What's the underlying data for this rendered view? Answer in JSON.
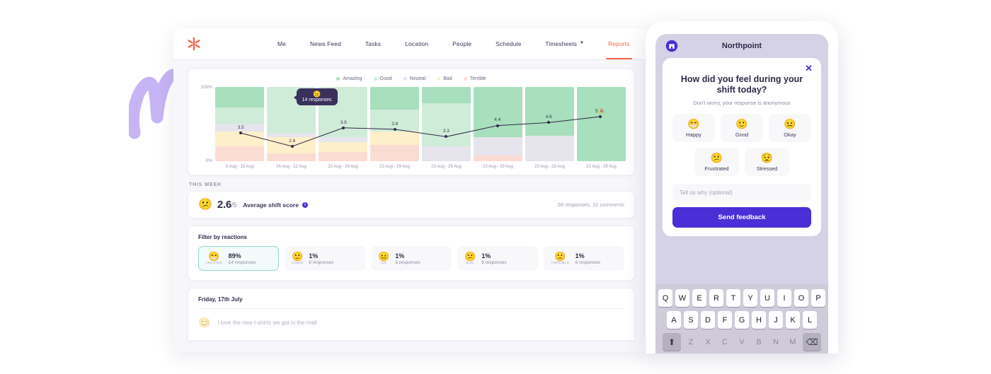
{
  "nav": {
    "logo_icon": "asterisk-logo-icon",
    "items": [
      {
        "label": "Me",
        "active": false,
        "caret": false
      },
      {
        "label": "News Feed",
        "active": false,
        "caret": false
      },
      {
        "label": "Tasks",
        "active": false,
        "caret": false
      },
      {
        "label": "Location",
        "active": false,
        "caret": false
      },
      {
        "label": "People",
        "active": false,
        "caret": false
      },
      {
        "label": "Schedule",
        "active": false,
        "caret": false
      },
      {
        "label": "Timesheets",
        "active": false,
        "caret": true
      },
      {
        "label": "Reports",
        "active": true,
        "caret": false
      }
    ]
  },
  "chart_data": {
    "type": "bar",
    "title": "",
    "xlabel": "",
    "ylabel": "",
    "ylim": [
      0,
      100
    ],
    "y_ticks": [
      "100%",
      "0%"
    ],
    "grid": false,
    "legend_position": "top-center",
    "legend": [
      {
        "name": "Amazing",
        "color": "#a8dfbc"
      },
      {
        "name": "Good",
        "color": "#cfecd8"
      },
      {
        "name": "Neutral",
        "color": "#e6e4ec"
      },
      {
        "name": "Bad",
        "color": "#fdefc9"
      },
      {
        "name": "Terrible",
        "color": "#fbdcd2"
      }
    ],
    "categories": [
      "9 Aug - 15 Aug",
      "16 Aug - 22 Aug",
      "23 Aug - 29 Aug",
      "23 Aug - 29 Aug",
      "23 Aug - 29 Aug",
      "23 Aug - 29 Aug",
      "23 Aug - 29 Aug",
      "23 Aug - 29 Aug"
    ],
    "series": [
      {
        "name": "Amazing",
        "values": [
          28,
          0,
          0,
          30,
          22,
          68,
          66,
          100
        ]
      },
      {
        "name": "Good",
        "values": [
          22,
          62,
          68,
          30,
          58,
          0,
          0,
          0
        ]
      },
      {
        "name": "Neutral",
        "values": [
          10,
          6,
          6,
          0,
          20,
          24,
          34,
          0
        ]
      },
      {
        "name": "Bad",
        "values": [
          20,
          22,
          14,
          18,
          0,
          0,
          0,
          0
        ]
      },
      {
        "name": "Terrible",
        "values": [
          20,
          10,
          12,
          22,
          0,
          8,
          0,
          0
        ]
      }
    ],
    "line_series": {
      "name": "Average shift score",
      "color": "#2f2947",
      "labels": [
        "3.5",
        "2.6",
        "3.9",
        "3.8",
        "3.3",
        "4.4",
        "4.6",
        "5 🎉"
      ],
      "values": [
        3.5,
        2.6,
        3.9,
        3.8,
        3.3,
        4.4,
        4.6,
        5.0
      ],
      "y_positions_pct": [
        62,
        80,
        55,
        57,
        67,
        52,
        48,
        40
      ]
    },
    "tooltip": {
      "emoji": "😐",
      "text": "14 responses",
      "bar_index": 1
    }
  },
  "this_week": {
    "section_label": "THIS WEEK",
    "emoji": "😕",
    "score": "2.6",
    "denominator": "/5",
    "label": "Average shift score",
    "info_icon": "info-icon",
    "summary": "58 responses, 32 comments"
  },
  "filters": {
    "title": "Filter by reactions",
    "chips": [
      {
        "emoji": "😁",
        "category": "AMAZING",
        "pct": "89%",
        "responses": "14 responses",
        "selected": true
      },
      {
        "emoji": "🙂",
        "category": "GOOD",
        "pct": "1%",
        "responses": "6 responses",
        "selected": false
      },
      {
        "emoji": "😐",
        "category": "OK",
        "pct": "1%",
        "responses": "6 responses",
        "selected": false
      },
      {
        "emoji": "😕",
        "category": "BAD",
        "pct": "1%",
        "responses": "6 responses",
        "selected": false
      },
      {
        "emoji": "🙁",
        "category": "TERRIBLE",
        "pct": "1%",
        "responses": "6 responses",
        "selected": false
      }
    ]
  },
  "comments": {
    "date": "Friday, 17th July",
    "items": [
      {
        "emoji": "😊",
        "text": "I love the new t-shirts we got in the mail"
      }
    ]
  },
  "phone": {
    "app_logo_icon": "store-logo-icon",
    "title": "Northpoint",
    "modal": {
      "close_icon": "close-icon",
      "title": "How did you feel during your shift today?",
      "subtitle": "Don't worry, your response is anonymous",
      "moods_row1": [
        {
          "emoji": "😁",
          "label": "Happy"
        },
        {
          "emoji": "🙂",
          "label": "Good"
        },
        {
          "emoji": "😐",
          "label": "Okay"
        }
      ],
      "moods_row2": [
        {
          "emoji": "😕",
          "label": "Frustrated"
        },
        {
          "emoji": "😟",
          "label": "Stressed"
        }
      ],
      "input_placeholder": "Tell us why (optional)",
      "send_label": "Send feedback"
    },
    "keyboard": {
      "row1": [
        "Q",
        "W",
        "E",
        "R",
        "T",
        "Y",
        "U",
        "I",
        "O",
        "P"
      ],
      "row2": [
        "A",
        "S",
        "D",
        "F",
        "G",
        "H",
        "J",
        "K",
        "L"
      ],
      "row3": [
        "Z",
        "X",
        "C",
        "V",
        "B",
        "N",
        "M"
      ],
      "shift_icon": "shift-icon",
      "backspace_icon": "backspace-icon"
    }
  },
  "colors": {
    "accent_orange": "#f4674e",
    "accent_purple": "#4a2fd6",
    "ink": "#2f2947"
  }
}
